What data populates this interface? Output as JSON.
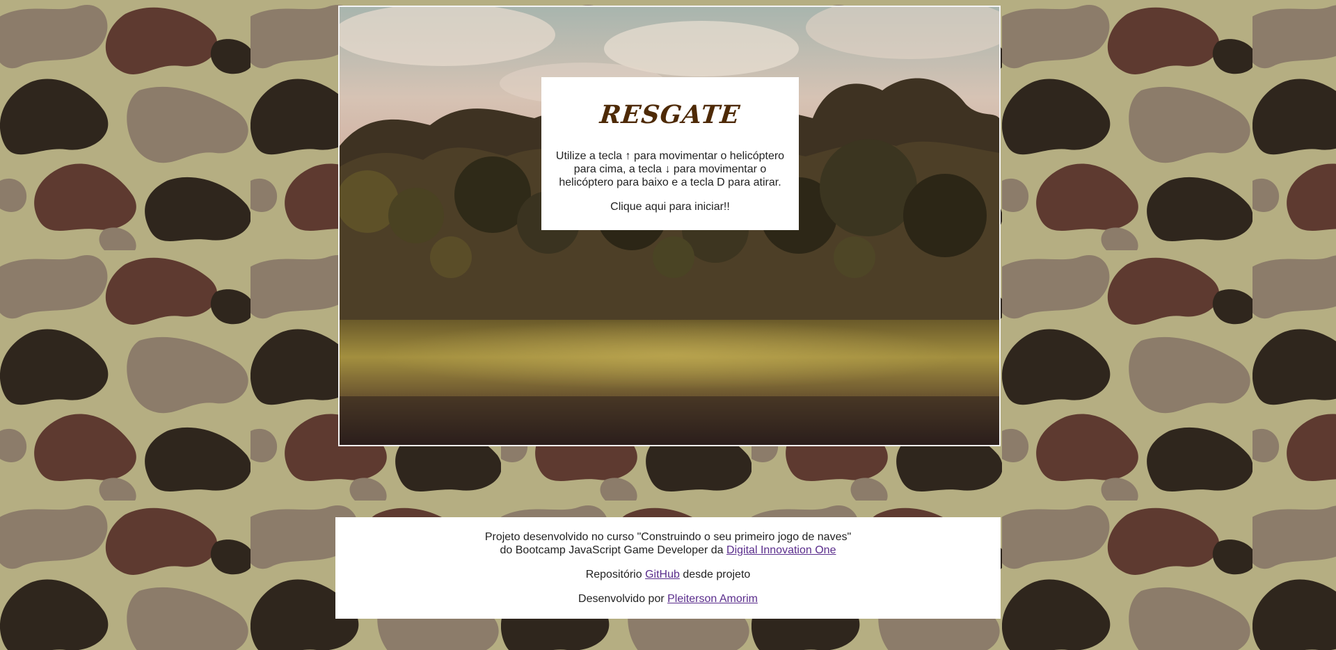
{
  "game": {
    "title": "RESGATE",
    "instructions": "Utilize a tecla ↑ para movimentar o helicóptero para cima, a tecla ↓ para movimentar o helicóptero para baixo e a tecla D para atirar.",
    "start_label": "Clique aqui para iniciar!!"
  },
  "footer": {
    "line1": "Projeto desenvolvido no curso \"Construindo o seu primeiro jogo de naves\"",
    "line2_prefix": "do Bootcamp JavaScript Game Developer da",
    "line2_link": "Digital Innovation One",
    "repo_prefix": "Repositório",
    "repo_link": "GitHub",
    "repo_suffix": "desde projeto",
    "author_prefix": "Desenvolvido por",
    "author_link": "Pleiterson Amorim"
  },
  "colors": {
    "camo_base": "#b5ae82",
    "camo_light": "#8c7c6a",
    "camo_brown": "#5e3a30",
    "camo_dark": "#2f261d",
    "title": "#4e2a06",
    "link": "#5a2d8c"
  }
}
